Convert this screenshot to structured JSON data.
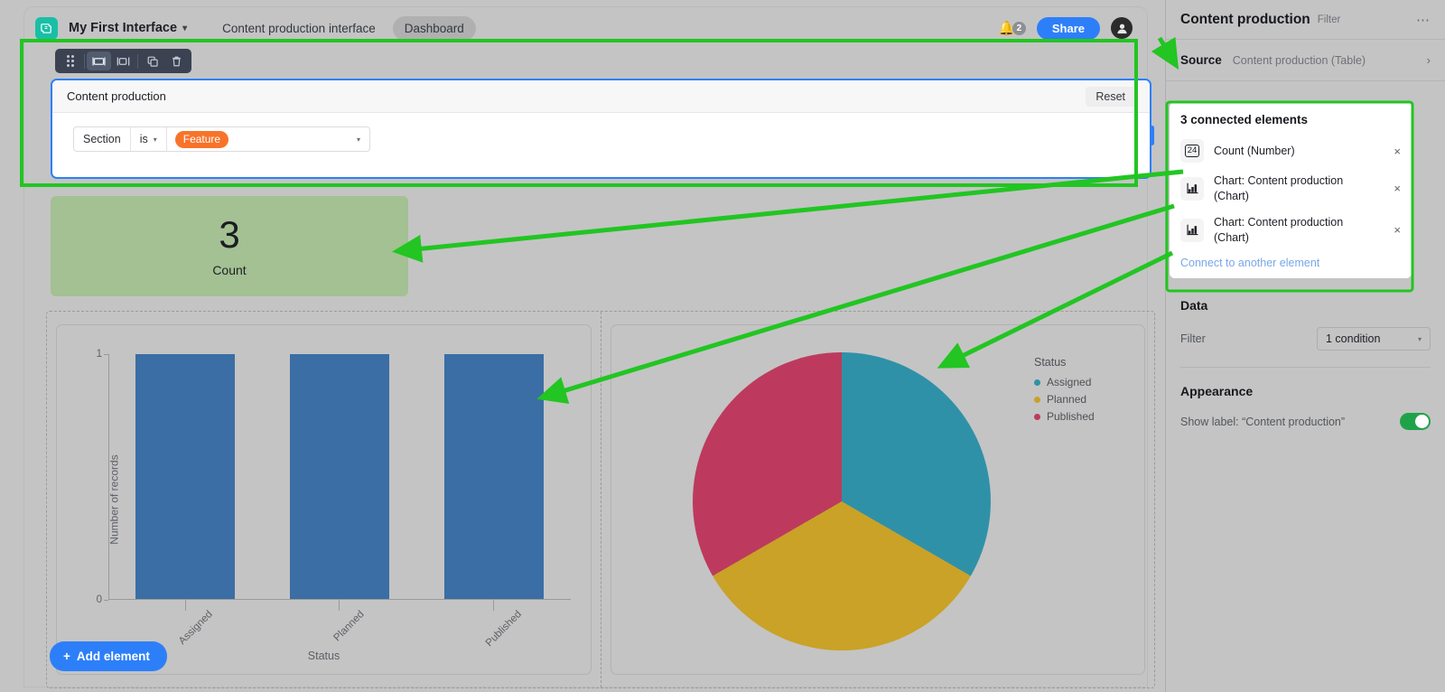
{
  "topbar": {
    "logo_icon": "airtable-logo-icon",
    "interface_name": "My First Interface",
    "chevron": "⌄",
    "tabs": [
      {
        "label": "Content production interface",
        "active": false
      },
      {
        "label": "Dashboard",
        "active": true
      }
    ],
    "bell_icon": "bell-icon",
    "notification_count": "2",
    "share_label": "Share",
    "avatar_glyph": "♟"
  },
  "element_toolbar": {
    "drag_handle_icon": "drag-handle-icon",
    "buttons": [
      {
        "name": "fit-width-icon",
        "active": true
      },
      {
        "name": "half-width-icon",
        "active": false
      },
      {
        "name": "duplicate-icon",
        "active": false
      },
      {
        "name": "delete-icon",
        "active": false
      }
    ]
  },
  "filter_block": {
    "title": "Content production",
    "reset_label": "Reset",
    "condition": {
      "field": "Section",
      "operator": "is",
      "operator_caret": "▾",
      "value_tag": "Feature",
      "value_caret": "▾"
    }
  },
  "count_card": {
    "value": "3",
    "label": "Count",
    "background": "#a3c193"
  },
  "add_element": {
    "plus": "+",
    "label": "Add element"
  },
  "sidebar": {
    "title": "Content production",
    "subtitle": "Filter",
    "overflow_icon": "more-options-icon",
    "source_label": "Source",
    "source_value": "Content production (Table)",
    "source_chevron": "›",
    "connected": {
      "title": "3 connected elements",
      "items": [
        {
          "icon": "number-24-icon",
          "icon_text": "24",
          "label": "Count (Number)",
          "close": "×"
        },
        {
          "icon": "bar-chart-icon",
          "icon_text": "",
          "label": "Chart: Content production (Chart)",
          "close": "×"
        },
        {
          "icon": "bar-chart-icon",
          "icon_text": "",
          "label": "Chart: Content production (Chart)",
          "close": "×"
        }
      ],
      "connect_link": "Connect to another element"
    },
    "data": {
      "title": "Data",
      "filter_label": "Filter",
      "filter_value": "1 condition",
      "caret": "▾"
    },
    "appearance": {
      "title": "Appearance",
      "show_label_text": "Show label: “Content production”",
      "toggle_on": true,
      "toggle_color": "#1fa34a"
    }
  },
  "chart_data": [
    {
      "type": "bar",
      "title": "",
      "categories": [
        "Assigned",
        "Planned",
        "Published"
      ],
      "values": [
        1,
        1,
        1
      ],
      "xlabel": "Status",
      "ylabel": "Number of records",
      "yticks": [
        "0",
        "1"
      ],
      "ylim": [
        0,
        1
      ],
      "grid": false,
      "bar_color": "#3a6ea5"
    },
    {
      "type": "pie",
      "title": "",
      "legend_title": "Status",
      "legend_position": "right",
      "labels": [
        "Assigned",
        "Planned",
        "Published"
      ],
      "values": [
        1,
        1,
        1
      ],
      "percentages": [
        33.3,
        33.3,
        33.3
      ],
      "colors": [
        "#2f91a8",
        "#c9a227",
        "#bd3a5e"
      ]
    }
  ]
}
